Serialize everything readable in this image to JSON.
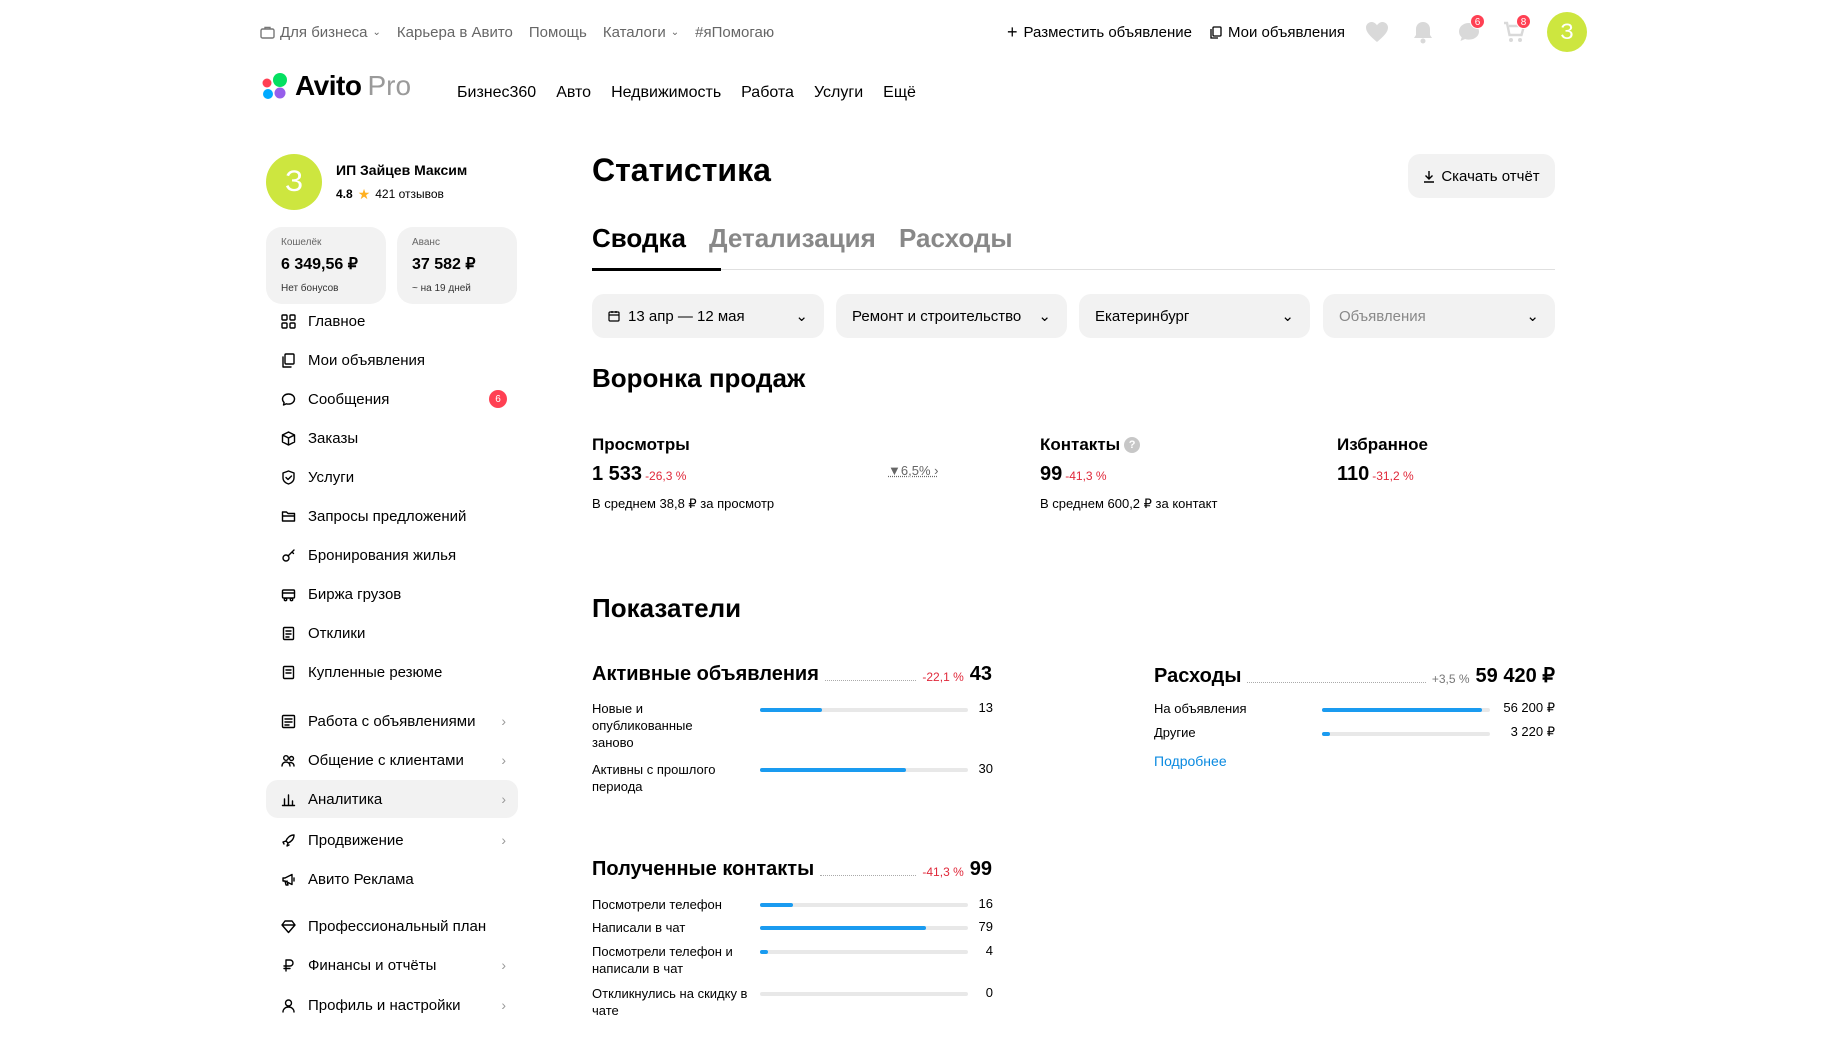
{
  "topbar": {
    "links": [
      "Для бизнеса",
      "Карьера в Авито",
      "Помощь",
      "Каталоги",
      "#яПомогаю"
    ],
    "post_ad": "Разместить объявление",
    "my_ads": "Мои объявления",
    "messages_badge": "6",
    "cart_badge": "8",
    "avatar_letter": "З"
  },
  "logo": {
    "word": "Avito",
    "suffix": "Pro"
  },
  "mainnav": [
    "Бизнес360",
    "Авто",
    "Недвижимость",
    "Работа",
    "Услуги",
    "Ещё"
  ],
  "profile": {
    "avatar_letter": "З",
    "name": "ИП Зайцев Максим",
    "rating": "4.8",
    "reviews": "421 отзывов"
  },
  "wallets": [
    {
      "title": "Кошелёк",
      "value": "6 349,56 ₽",
      "sub": "Нет бонусов"
    },
    {
      "title": "Аванс",
      "value": "37 582 ₽",
      "sub": "~ на 19 дней"
    }
  ],
  "sidebar": {
    "items": [
      {
        "label": "Главное",
        "icon": "grid-icon"
      },
      {
        "label": "Мои объявления",
        "icon": "copy-icon"
      },
      {
        "label": "Сообщения",
        "icon": "chat-icon",
        "badge": "6"
      },
      {
        "label": "Заказы",
        "icon": "box-icon"
      },
      {
        "label": "Услуги",
        "icon": "shield-icon"
      },
      {
        "label": "Запросы предложений",
        "icon": "folder-icon"
      },
      {
        "label": "Бронирования жилья",
        "icon": "key-icon"
      },
      {
        "label": "Биржа грузов",
        "icon": "truck-icon"
      },
      {
        "label": "Отклики",
        "icon": "doc-icon"
      },
      {
        "label": "Купленные резюме",
        "icon": "resume-icon"
      },
      {
        "label": "Работа с объявлениями",
        "icon": "list-icon",
        "chevron": true
      },
      {
        "label": "Общение с клиентами",
        "icon": "people-icon",
        "chevron": true
      },
      {
        "label": "Аналитика",
        "icon": "chart-icon",
        "chevron": true,
        "active": true
      },
      {
        "label": "Продвижение",
        "icon": "rocket-icon",
        "chevron": true
      },
      {
        "label": "Авито Реклама",
        "icon": "megaphone-icon"
      },
      {
        "label": "Профессиональный план",
        "icon": "diamond-icon"
      },
      {
        "label": "Финансы и отчёты",
        "icon": "ruble-icon",
        "chevron": true
      },
      {
        "label": "Профиль и настройки",
        "icon": "user-icon",
        "chevron": true
      }
    ]
  },
  "page": {
    "title": "Статистика",
    "download": "Скачать отчёт",
    "tabs": [
      "Сводка",
      "Детализация",
      "Расходы"
    ]
  },
  "filters": {
    "period": "13 апр — 12 мая",
    "category": "Ремонт и строительство",
    "city": "Екатеринбург",
    "type_placeholder": "Объявления"
  },
  "funnel": {
    "title": "Воронка продаж",
    "views": {
      "label": "Просмотры",
      "value": "1 533",
      "change": "-26,3 %",
      "sub": "В среднем 38,8 ₽ за просмотр"
    },
    "conversion": "6,5%",
    "contacts": {
      "label": "Контакты",
      "value": "99",
      "change": "-41,3 %",
      "sub": "В среднем 600,2 ₽ за контакт"
    },
    "favorites": {
      "label": "Избранное",
      "value": "110",
      "change": "-31,2 %"
    }
  },
  "metrics": {
    "title": "Показатели",
    "active_ads": {
      "label": "Активные объявления",
      "change": "-22,1 %",
      "value": "43",
      "rows": [
        {
          "label": "Новые и опубликованные заново",
          "value": "13",
          "fill": 0.3
        },
        {
          "label": "Активны с прошлого периода",
          "value": "30",
          "fill": 0.7
        }
      ]
    },
    "expenses": {
      "label": "Расходы",
      "change": "+3,5 %",
      "value": "59 420 ₽",
      "rows": [
        {
          "label": "На объявления",
          "value": "56 200 ₽",
          "fill": 0.95
        },
        {
          "label": "Другие",
          "value": "3 220 ₽",
          "fill": 0.05
        }
      ],
      "more": "Подробнее"
    },
    "contacts": {
      "label": "Полученные контакты",
      "change": "-41,3 %",
      "value": "99",
      "rows": [
        {
          "label": "Посмотрели телефон",
          "value": "16",
          "fill": 0.16
        },
        {
          "label": "Написали в чат",
          "value": "79",
          "fill": 0.8
        },
        {
          "label": "Посмотрели телефон и написали в чат",
          "value": "4",
          "fill": 0.04
        },
        {
          "label": "Откликнулись на скидку в чате",
          "value": "0",
          "fill": 0
        }
      ]
    }
  }
}
